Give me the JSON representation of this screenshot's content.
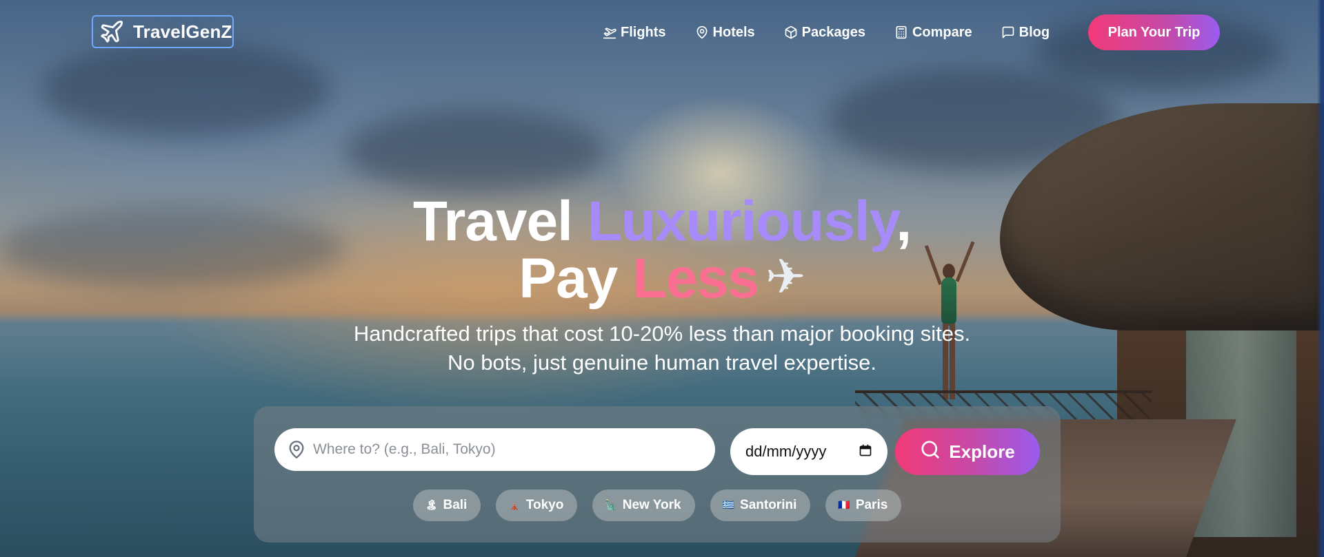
{
  "brand": {
    "name": "TravelGenZ",
    "icon": "plane-icon"
  },
  "nav": {
    "items": [
      {
        "label": "Flights",
        "icon": "plane-departure-icon"
      },
      {
        "label": "Hotels",
        "icon": "map-pin-icon"
      },
      {
        "label": "Packages",
        "icon": "package-icon"
      },
      {
        "label": "Compare",
        "icon": "calculator-icon"
      },
      {
        "label": "Blog",
        "icon": "chat-icon"
      }
    ],
    "cta_label": "Plan Your Trip"
  },
  "hero": {
    "line1_part1": "Travel ",
    "line1_accent": "Luxuriously",
    "line1_end": ",",
    "line2_part1": "Pay ",
    "line2_accent": "Less",
    "line2_emoji": "✈",
    "subtitle_line1": "Handcrafted trips that cost 10-20% less than major booking sites.",
    "subtitle_line2": "No bots, just genuine human travel expertise."
  },
  "search": {
    "placeholder": "Where to? (e.g., Bali, Tokyo)",
    "value": "",
    "date_placeholder": "dd/mm/yyyy",
    "explore_label": "Explore"
  },
  "quick_destinations": [
    {
      "flag": "🏝",
      "label": "Bali"
    },
    {
      "flag": "🗼",
      "label": "Tokyo"
    },
    {
      "flag": "🗽",
      "label": "New York"
    },
    {
      "flag": "🇬🇷",
      "label": "Santorini"
    },
    {
      "flag": "🇫🇷",
      "label": "Paris"
    }
  ],
  "colors": {
    "accent_purple": "#a78bfa",
    "accent_pink": "#fb6f92",
    "cta_gradient_start": "#f23a78",
    "cta_gradient_end": "#9a5cf0"
  }
}
